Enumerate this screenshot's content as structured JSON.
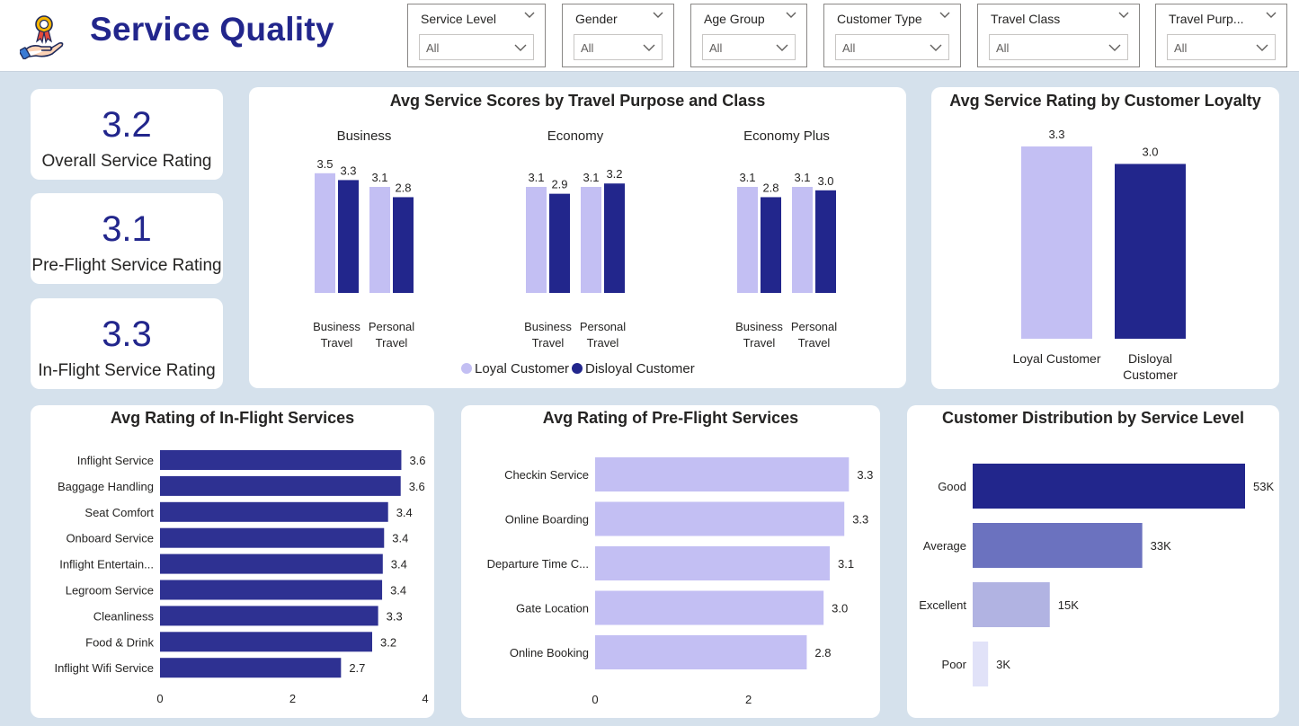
{
  "header": {
    "title": "Service Quality",
    "logo_icon": "hand-award-icon"
  },
  "slicers": [
    {
      "label": "Service Level",
      "value": "All"
    },
    {
      "label": "Gender",
      "value": "All"
    },
    {
      "label": "Age Group",
      "value": "All"
    },
    {
      "label": "Customer Type",
      "value": "All"
    },
    {
      "label": "Travel Class",
      "value": "All"
    },
    {
      "label": "Travel Purp...",
      "value": "All"
    }
  ],
  "kpis": [
    {
      "value": "3.2",
      "label": "Overall Service Rating"
    },
    {
      "value": "3.1",
      "label": "Pre-Flight Service Rating"
    },
    {
      "value": "3.3",
      "label": "In-Flight Service Rating"
    }
  ],
  "colors": {
    "loyal": "#c3bff3",
    "disloyal": "#22268c",
    "inflight_bar": "#2e3192",
    "preflight_bar": "#c3bff3",
    "dist_good": "#22268c",
    "dist_average": "#6b72bf",
    "dist_excellent": "#b1b3e2",
    "dist_poor": "#e1e2f8",
    "title": "#22268c"
  },
  "chart_data": [
    {
      "type": "bar",
      "title": "Avg Service Scores by Travel Purpose and Class",
      "panels": [
        {
          "name": "Business",
          "categories": [
            "Business Travel",
            "Personal Travel"
          ],
          "series": [
            {
              "name": "Loyal Customer",
              "values": [
                3.5,
                3.1
              ]
            },
            {
              "name": "Disloyal Customer",
              "values": [
                3.3,
                2.8
              ]
            }
          ]
        },
        {
          "name": "Economy",
          "categories": [
            "Business Travel",
            "Personal Travel"
          ],
          "series": [
            {
              "name": "Loyal Customer",
              "values": [
                3.1,
                3.1
              ]
            },
            {
              "name": "Disloyal Customer",
              "values": [
                2.9,
                3.2
              ]
            }
          ]
        },
        {
          "name": "Economy Plus",
          "categories": [
            "Business Travel",
            "Personal Travel"
          ],
          "series": [
            {
              "name": "Loyal Customer",
              "values": [
                3.1,
                3.1
              ]
            },
            {
              "name": "Disloyal Customer",
              "values": [
                2.8,
                3.0
              ]
            }
          ]
        }
      ],
      "legend": [
        "Loyal Customer",
        "Disloyal Customer"
      ],
      "legend_position": "bottom",
      "ylim": [
        0,
        3.6
      ]
    },
    {
      "type": "bar",
      "title": "Avg Service Rating by Customer Loyalty",
      "categories": [
        "Loyal Customer",
        "Disloyal Customer"
      ],
      "values": [
        3.3,
        3.0
      ],
      "labels": [
        "3.3",
        "3.0"
      ],
      "ylim": [
        0,
        3.3
      ]
    },
    {
      "type": "bar",
      "orientation": "horizontal",
      "title": "Avg Rating of In-Flight Services",
      "categories": [
        "Inflight Service",
        "Baggage Handling",
        "Seat Comfort",
        "Onboard Service",
        "Inflight Entertain...",
        "Legroom Service",
        "Cleanliness",
        "Food & Drink",
        "Inflight Wifi Service"
      ],
      "values": [
        3.64,
        3.63,
        3.44,
        3.38,
        3.36,
        3.35,
        3.29,
        3.2,
        2.73
      ],
      "labels": [
        "3.6",
        "3.6",
        "3.4",
        "3.4",
        "3.4",
        "3.4",
        "3.3",
        "3.2",
        "2.7"
      ],
      "xticks": [
        "0",
        "2",
        "4"
      ],
      "xlim": [
        0,
        4
      ]
    },
    {
      "type": "bar",
      "orientation": "horizontal",
      "title": "Avg Rating of Pre-Flight Services",
      "categories": [
        "Checkin Service",
        "Online Boarding",
        "Departure Time C...",
        "Gate Location",
        "Online Booking"
      ],
      "values": [
        3.31,
        3.25,
        3.06,
        2.98,
        2.76
      ],
      "labels": [
        "3.3",
        "3.3",
        "3.1",
        "3.0",
        "2.8"
      ],
      "xticks": [
        "0",
        "2"
      ],
      "xlim": [
        0,
        3.4
      ]
    },
    {
      "type": "bar",
      "orientation": "horizontal",
      "title": "Customer Distribution by Service Level",
      "categories": [
        "Good",
        "Average",
        "Excellent",
        "Poor"
      ],
      "values": [
        53000,
        33000,
        15000,
        3000
      ],
      "labels": [
        "53K",
        "33K",
        "15K",
        "3K"
      ],
      "xlim": [
        0,
        53000
      ]
    }
  ]
}
